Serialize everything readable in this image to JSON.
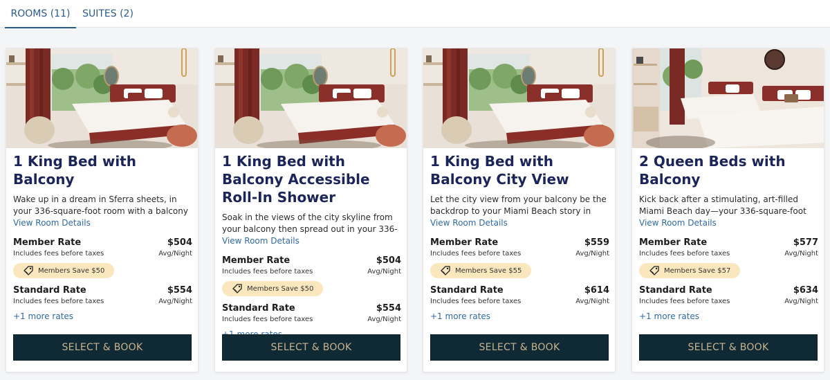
{
  "tabs": [
    {
      "label": "ROOMS (11)",
      "active": true
    },
    {
      "label": "SUITES (2)",
      "active": false
    }
  ],
  "colors": {
    "accent": "#2a5a8e",
    "title": "#1b2559",
    "badge_bg": "#fbe7be",
    "button_bg": "#0f2a34",
    "button_text": "#c9b38f"
  },
  "rooms": [
    {
      "title": "1 King Bed with Balcony",
      "description": "Wake up in a dream in Sferra sheets, in your 336-square-foot room with a balcony and a…",
      "details_link": "View Room Details",
      "member_rate": {
        "name": "Member Rate",
        "note": "Includes fees before taxes",
        "price": "$504",
        "unit": "Avg/Night"
      },
      "badge": "Members Save $50",
      "standard_rate": {
        "name": "Standard Rate",
        "note": "Includes fees before taxes",
        "price": "$554",
        "unit": "Avg/Night"
      },
      "more_rates": "+1 more rates",
      "button": "SELECT & BOOK"
    },
    {
      "title": "1 King Bed with Balcony Accessible Roll-In Shower",
      "description": "Soak in the views of the city skyline from your balcony then spread out in your 336-square-…",
      "details_link": "View Room Details",
      "member_rate": {
        "name": "Member Rate",
        "note": "Includes fees before taxes",
        "price": "$504",
        "unit": "Avg/Night"
      },
      "badge": "Members Save $50",
      "standard_rate": {
        "name": "Standard Rate",
        "note": "Includes fees before taxes",
        "price": "$554",
        "unit": "Avg/Night"
      },
      "more_rates": "+1 more rates",
      "button": "SELECT & BOOK"
    },
    {
      "title": "1 King Bed with Balcony City View",
      "description": "Let the city view from your balcony be the backdrop to your Miami Beach story in this…",
      "details_link": "View Room Details",
      "member_rate": {
        "name": "Member Rate",
        "note": "Includes fees before taxes",
        "price": "$559",
        "unit": "Avg/Night"
      },
      "badge": "Members Save $55",
      "standard_rate": {
        "name": "Standard Rate",
        "note": "Includes fees before taxes",
        "price": "$614",
        "unit": "Avg/Night"
      },
      "more_rates": "+1 more rates",
      "button": "SELECT & BOOK"
    },
    {
      "title": "2 Queen Beds with Balcony",
      "description": "Kick back after a stimulating, art-filled Miami Beach day—your 336-square-foot room has…",
      "details_link": "View Room Details",
      "member_rate": {
        "name": "Member Rate",
        "note": "Includes fees before taxes",
        "price": "$577",
        "unit": "Avg/Night"
      },
      "badge": "Members Save $57",
      "standard_rate": {
        "name": "Standard Rate",
        "note": "Includes fees before taxes",
        "price": "$634",
        "unit": "Avg/Night"
      },
      "more_rates": "+1 more rates",
      "button": "SELECT & BOOK"
    }
  ]
}
